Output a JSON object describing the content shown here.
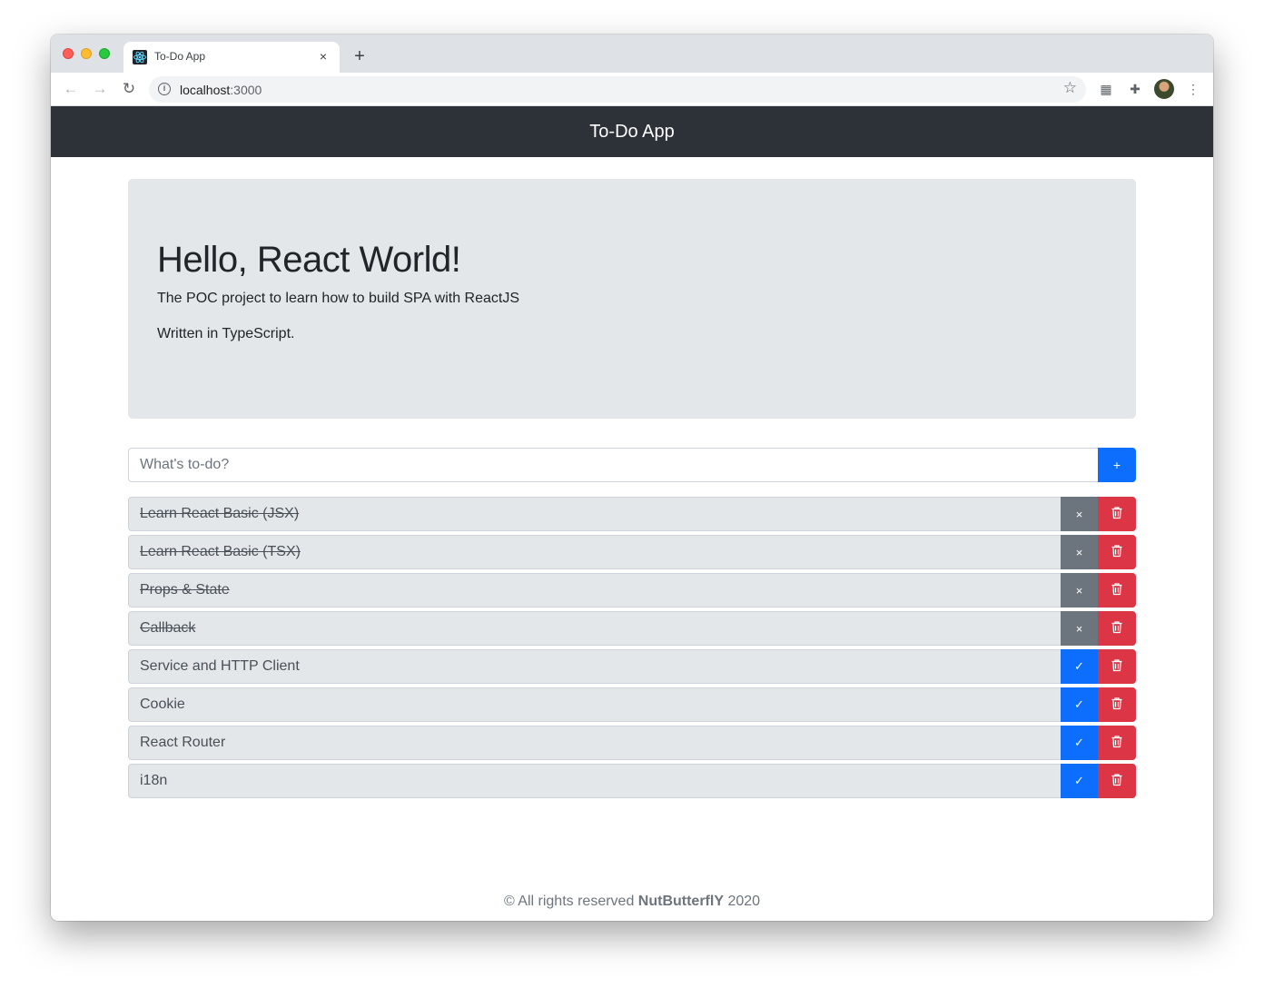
{
  "browser": {
    "tab_title": "To-Do App",
    "tab_close": "×",
    "new_tab": "+",
    "url_host": "localhost",
    "url_port": ":3000"
  },
  "app": {
    "navbar_title": "To-Do App",
    "jumbotron": {
      "title": "Hello, React World!",
      "subtitle": "The POC project to learn how to build SPA with ReactJS",
      "note": "Written in TypeScript."
    },
    "input": {
      "placeholder": "What's to-do?",
      "add_label": "+"
    },
    "todos": [
      {
        "text": "Learn React Basic (JSX)",
        "done": true,
        "toggle_icon": "×"
      },
      {
        "text": "Learn React Basic (TSX)",
        "done": true,
        "toggle_icon": "×"
      },
      {
        "text": "Props & State",
        "done": true,
        "toggle_icon": "×"
      },
      {
        "text": "Callback",
        "done": true,
        "toggle_icon": "×"
      },
      {
        "text": "Service and HTTP Client",
        "done": false,
        "toggle_icon": "✓"
      },
      {
        "text": "Cookie",
        "done": false,
        "toggle_icon": "✓"
      },
      {
        "text": "React Router",
        "done": false,
        "toggle_icon": "✓"
      },
      {
        "text": "i18n",
        "done": false,
        "toggle_icon": "✓"
      }
    ],
    "footer": {
      "prefix": "© All rights reserved ",
      "author": "NutButterflY",
      "year": " 2020"
    }
  },
  "colors": {
    "navbar": "#2d3238",
    "primary": "#0d6efd",
    "secondary": "#6c757d",
    "danger": "#dc3545",
    "jumbotron": "#e4e7ea"
  }
}
